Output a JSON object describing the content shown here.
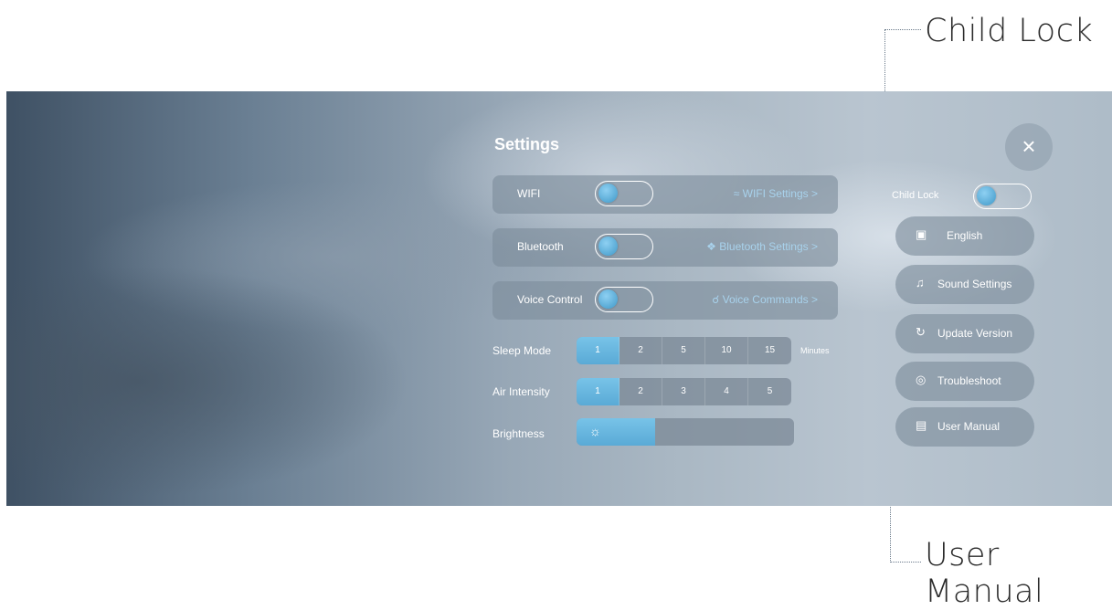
{
  "annotations": {
    "child_lock": "Child Lock",
    "user_manual": "User Manual"
  },
  "settings": {
    "title": "Settings",
    "rows": [
      {
        "label": "WIFI",
        "link": "WIFI Settings  >",
        "link_icon": "wifi-icon",
        "toggle_on": false
      },
      {
        "label": "Bluetooth",
        "link": "Bluetooth Settings  >",
        "link_icon": "bluetooth-icon",
        "toggle_on": false
      },
      {
        "label": "Voice Control",
        "link": "Voice  Commands  >",
        "link_icon": "microphone-icon",
        "toggle_on": false
      }
    ],
    "sleep_mode": {
      "label": "Sleep Mode",
      "options": [
        "1",
        "2",
        "5",
        "10",
        "15"
      ],
      "selected": "1",
      "unit": "Minutes"
    },
    "air_intensity": {
      "label": "Air Intensity",
      "options": [
        "1",
        "2",
        "3",
        "4",
        "5"
      ],
      "selected": "1"
    },
    "brightness": {
      "label": "Brightness",
      "level_fraction": 0.36
    }
  },
  "side_panel": {
    "close_icon": "close-icon",
    "child_lock": {
      "label": "Child Lock",
      "toggle_on": false
    },
    "buttons": [
      {
        "label": "English",
        "icon": "language-icon"
      },
      {
        "label": "Sound Settings",
        "icon": "sound-icon"
      },
      {
        "label": "Update Version",
        "icon": "refresh-icon"
      },
      {
        "label": "Troubleshoot",
        "icon": "lifebuoy-icon"
      },
      {
        "label": "User Manual",
        "icon": "book-icon"
      }
    ]
  },
  "colors": {
    "accent": "#5aaad6",
    "link": "#a8d2ec"
  }
}
